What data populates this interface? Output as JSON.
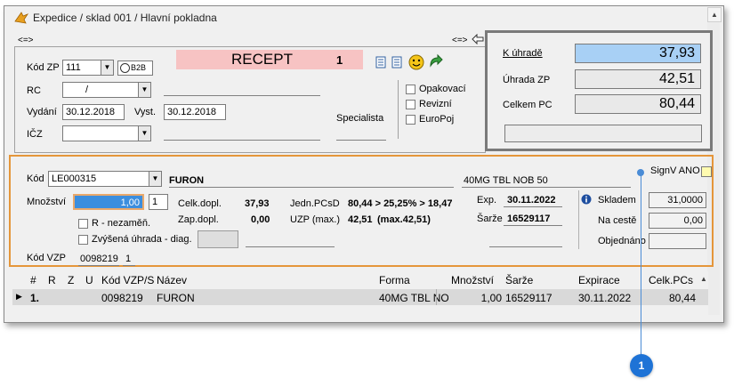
{
  "window": {
    "title": "Expedice / sklad 001 / Hlavní pokladna"
  },
  "nav": {
    "left_arrows": "<=>",
    "right_arrows": "<=>"
  },
  "prescription": {
    "kod_zp_label": "Kód ZP",
    "kod_zp_value": "111",
    "b2b_label": "B2B",
    "rc_label": "RC",
    "rc_value": "/",
    "vydani_label": "Vydání",
    "vydani_value": "30.12.2018",
    "vyst_label": "Vyst.",
    "vyst_value": "30.12.2018",
    "icz_label": "IČZ",
    "icz_value": "",
    "specialista_label": "Specialista",
    "recept_title": "RECEPT",
    "recept_number": "1",
    "checkboxes": [
      "Opakovací",
      "Revizní",
      "EuroPoj"
    ]
  },
  "summary": {
    "k_uhrade_label": "K úhradě",
    "k_uhrade_value": "37,93",
    "uhrada_zp_label": "Úhrada ZP",
    "uhrada_zp_value": "42,51",
    "celkem_pc_label": "Celkem PC",
    "celkem_pc_value": "80,44"
  },
  "item": {
    "kod_label": "Kód",
    "kod_value": "LE000315",
    "name": "FURON",
    "form": "40MG TBL NOB 50",
    "signv_label": "SignV ANO",
    "mnozstvi_label": "Množství",
    "mnozstvi_value": "1,00",
    "mnozstvi_unit": "1",
    "celk_dopl_label": "Celk.dopl.",
    "celk_dopl_value": "37,93",
    "zap_dopl_label": "Zap.dopl.",
    "zap_dopl_value": "0,00",
    "jedn_pcsd_label": "Jedn.PCsD",
    "jedn_pcsd_value": "80,44 > 25,25% > 18,47",
    "uzp_label": "UZP (max.)",
    "uzp_value": "42,51",
    "uzp_max": "(max.42,51)",
    "r_nezamen_label": "R - nezaměň.",
    "zvysena_label": "Zvýšená úhrada - diag.",
    "exp_label": "Exp.",
    "exp_value": "30.11.2022",
    "sarze_label": "Šarže",
    "sarze_value": "16529117",
    "skladem_label": "Skladem",
    "skladem_value": "31,0000",
    "na_ceste_label": "Na cestě",
    "na_ceste_value": "0,00",
    "objednano_label": "Objednáno",
    "objednano_value": "",
    "kod_vzp_label": "Kód VZP",
    "kod_vzp_value": "0098219",
    "kod_vzp_suffix": "1"
  },
  "grid": {
    "headers": [
      "#",
      "R",
      "Z",
      "U",
      "Kód VZP/S",
      "Název",
      "Forma",
      "Množství",
      "Šarže",
      "Expirace",
      "Celk.PCs"
    ],
    "rows": [
      {
        "num": "1.",
        "kod": "0098219",
        "nazev": "FURON",
        "forma": "40MG TBL NO",
        "mnozstvi": "1,00",
        "sarze": "16529117",
        "expirace": "30.11.2022",
        "celk": "80,44"
      }
    ]
  },
  "callout": {
    "number": "1"
  },
  "colors": {
    "highlight_blue": "#a8d0f5",
    "recept_pink": "#f7c3c3",
    "orange_border": "#e5963a",
    "callout_blue": "#1e73d6"
  }
}
